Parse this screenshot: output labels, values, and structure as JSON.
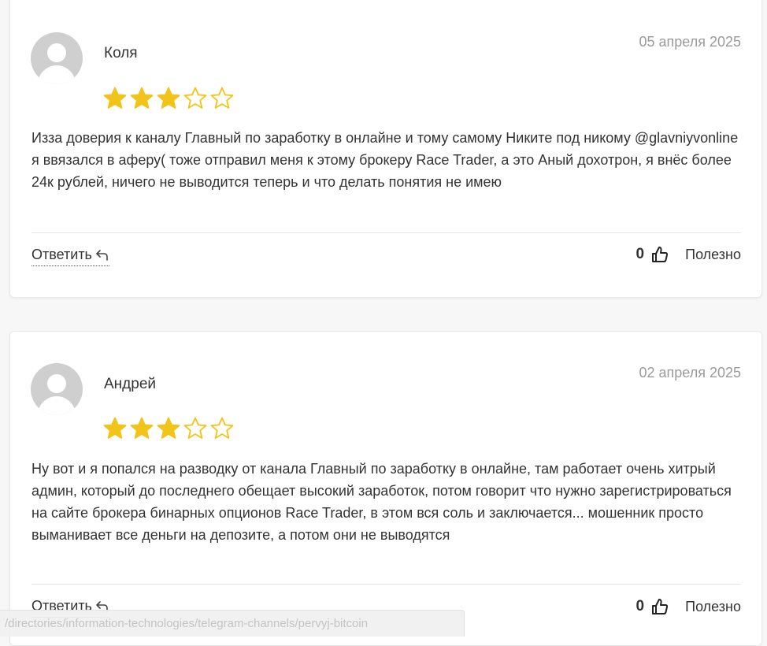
{
  "reviews": [
    {
      "author": "Коля",
      "date": "05 апреля 2025",
      "rating": 3,
      "max_rating": 5,
      "text": "Изза доверия к каналу Главный по заработку в онлайне и тому самому Никите под никому @glavniyvonline я ввязался в аферу( тоже отправил меня к этому брокеру Race Trader, а это Аный дохотрон, я внёс более 24к рублей, ничего не выводится теперь и что делать понятия не имею",
      "reply_label": "Ответить",
      "helpful_count": "0",
      "helpful_label": "Полезно"
    },
    {
      "author": "Андрей",
      "date": "02 апреля 2025",
      "rating": 3,
      "max_rating": 5,
      "text": "Ну вот и я попался на разводку от канала Главный по заработку в онлайне, там работает очень хитрый админ, который до последнего обещает высокий заработок, потом говорит что нужно зарегистрироваться на сайте брокера бинарных опционов Race Trader, в этом вся соль и заключается... мошенник просто выманивает все деньги на депозите, а потом они не выводятся",
      "reply_label": "Ответить",
      "helpful_count": "0",
      "helpful_label": "Полезно"
    }
  ],
  "status_bar": {
    "url": "/directories/information-technologies/telegram-channels/pervyj-bitcoin"
  },
  "colors": {
    "star_filled": "#f0c419",
    "star_empty_stroke": "#f0c419",
    "avatar_bg": "#cfcfcf",
    "date_text": "#9a9a9a"
  },
  "icons": {
    "reply": "reply-arrow-icon",
    "helpful": "thumbs-up-icon",
    "avatar": "user-silhouette-icon",
    "star": "star-icon"
  }
}
